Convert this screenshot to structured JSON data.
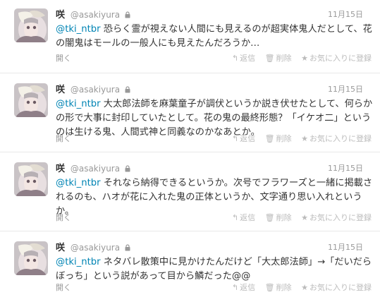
{
  "tweets": [
    {
      "name": "咲",
      "handle": "@asakiyura",
      "time": "11月15日",
      "mention": "@tki_ntbr",
      "text": " 恐らく霊が視えない人間にも見えるのが超実体鬼人だとして、花の闇鬼はモールの一般人にも見えたんだろうか…",
      "expand": "開く"
    },
    {
      "name": "咲",
      "handle": "@asakiyura",
      "time": "11月15日",
      "mention": "@tki_ntbr",
      "text": " 大太郎法師を麻葉童子が調伏というか説き伏せたとして、何らかの形で大事に封印していたとして。花の鬼の最終形態？「イケオ二」というのは生ける鬼、人間式神と同義なのかなあとか。",
      "expand": "開く"
    },
    {
      "name": "咲",
      "handle": "@asakiyura",
      "time": "11月15日",
      "mention": "@tki_ntbr",
      "text": " それなら納得できるというか。次号でフラワーズと一緒に掲載されるのも、ハオが花に入れた鬼の正体というか、文字通り思い入れというか。",
      "expand": "開く"
    },
    {
      "name": "咲",
      "handle": "@asakiyura",
      "time": "11月15日",
      "mention": "@tki_ntbr",
      "text": " ネタバレ散策中に見かけたんだけど「大太郎法師」→「だいだらぼっち」という説があって目から鱗だった@@",
      "expand": "開く"
    }
  ],
  "actions": {
    "reply": "返信",
    "delete": "削除",
    "favorite": "お気に入りに登録"
  },
  "icons": {
    "avatar": "avatar-icon",
    "lock": "lock-icon",
    "reply": "reply-icon",
    "delete": "trash-icon",
    "favorite": "star-icon"
  }
}
